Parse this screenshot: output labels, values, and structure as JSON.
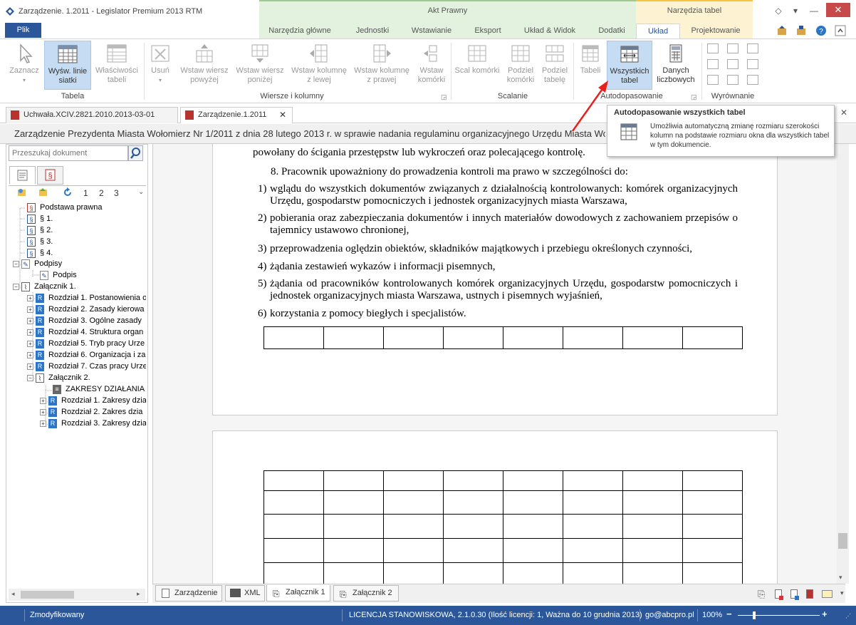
{
  "window": {
    "title": "Zarządzenie. 1.2011 - Legislator Premium 2013 RTM",
    "controls": [
      "◇",
      "▾",
      "—",
      "✕"
    ]
  },
  "context_groups": {
    "akt": "Akt Prawny",
    "tabele": "Narzędzia tabel"
  },
  "ribbon_tabs": [
    "Plik",
    "Narzędzia główne",
    "Jednostki",
    "Wstawianie",
    "Eksport",
    "Układ & Widok",
    "Dodatki",
    "Układ",
    "Projektowanie"
  ],
  "ribbon": {
    "buttons": {
      "zaznacz": "Zaznacz",
      "wysw1": "Wyśw. linie",
      "wysw2": "siatki",
      "wlasc1": "Właściwości",
      "wlasc2": "tabeli",
      "usun": "Usuń",
      "wwp1": "Wstaw wiersz",
      "wwp2": "powyżej",
      "wwn1": "Wstaw wiersz",
      "wwn2": "poniżej",
      "wkl1": "Wstaw kolumnę",
      "wkl2": "z lewej",
      "wkp1": "Wstaw kolumnę",
      "wkp2": "z prawej",
      "wk1": "Wstaw",
      "wk2": "komórki",
      "scal": "Scal komórki",
      "pk1": "Podziel",
      "pk2": "komórki",
      "pt1": "Podziel",
      "pt2": "tabelę",
      "tabeli": "Tabeli",
      "wt1": "Wszystkich",
      "wt2": "tabel",
      "dl1": "Danych",
      "dl2": "liczbowych"
    },
    "groups": [
      "Tabela",
      "Wiersze i kolumny",
      "Scalanie",
      "Autodopasowanie",
      "Wyrównanie"
    ]
  },
  "doc_tabs": [
    "Uchwała.XCIV.2821.2010.2013-03-01",
    "Zarządzenie.1.2011"
  ],
  "doc_title": "Zarządzenie Prezydenta Miasta Wołomierz Nr 1/2011 z dnia 28 lutego 2013 r. w sprawie nadania regulaminu organizacyjnego Urzędu Miasta Wołomierz",
  "tooltip": {
    "title": "Autodopasowanie wszystkich tabel",
    "body": "Umożliwia automatyczną zmianę rozmiaru szerokości kolumn na podstawie rozmiaru okna dla wszystkich tabel w tym dokumencie."
  },
  "search": {
    "placeholder": "Przeszukaj dokument"
  },
  "tree_toolbar": {
    "levels": [
      "1",
      "2",
      "3"
    ]
  },
  "tree": [
    {
      "label": "Podstawa prawna"
    },
    {
      "label": "§ 1."
    },
    {
      "label": "§ 2."
    },
    {
      "label": "§ 3."
    },
    {
      "label": "§ 4."
    },
    {
      "label": "Podpisy"
    },
    {
      "label": "Podpis"
    },
    {
      "label": "Załącznik 1."
    },
    {
      "label": "Rozdział 1. Postanowienia o"
    },
    {
      "label": "Rozdział 2. Zasady kierowa"
    },
    {
      "label": "Rozdział 3. Ogólne zasady"
    },
    {
      "label": "Rozdział 4. Struktura organ"
    },
    {
      "label": "Rozdział 5. Tryb pracy Urze"
    },
    {
      "label": "Rozdział 6. Organizacja i za"
    },
    {
      "label": "Rozdział 7. Czas pracy Urze"
    },
    {
      "label": "Załącznik 2."
    },
    {
      "label": "ZAKRESY DZIAŁANIA B"
    },
    {
      "label": "Rozdział 1. Zakresy dzia"
    },
    {
      "label": "Rozdział 2. Zakres dzia"
    },
    {
      "label": "Rozdział 3. Zakresy dzia"
    }
  ],
  "document": {
    "line0": "powołany do ścigania przestępstw lub wykroczeń oraz polecającego kontrolę.",
    "para8": "8. Pracownik upoważniony do prowadzenia kontroli ma prawo w szczególności do:",
    "items": [
      {
        "n": "1)",
        "t": "wglądu do wszystkich dokumentów związanych z działalnością kontrolowanych: komórek organizacyjnych Urzędu, gospodarstw pomocniczych i jednostek organizacyjnych miasta Warszawa,"
      },
      {
        "n": "2)",
        "t": "pobierania oraz zabezpieczania dokumentów i innych materiałów dowodowych z zachowaniem przepisów o tajemnicy ustawowo chronionej,"
      },
      {
        "n": "3)",
        "t": "przeprowadzenia oględzin obiektów, składników majątkowych i przebiegu określonych czynności,"
      },
      {
        "n": "4)",
        "t": "żądania zestawień wykazów i informacji pisemnych,"
      },
      {
        "n": "5)",
        "t": "żądania od pracowników kontrolowanych komórek organizacyjnych Urzędu, gospodarstw pomocniczych i jednostek organizacyjnych miasta Warszawa, ustnych i pisemnych wyjaśnień,"
      },
      {
        "n": "6)",
        "t": "korzystania z pomocy biegłych i specjalistów."
      }
    ]
  },
  "bottom_tabs": [
    "Zarządzenie",
    "XML",
    "Załącznik 1",
    "Załącznik 2"
  ],
  "status": {
    "state": "Zmodyfikowany",
    "license": "LICENCJA STANOWISKOWA, 2.1.0.30 (Ilość licencji: 1, Ważna do 10 grudnia 2013)",
    "email": "go@abcpro.pl",
    "zoom": "100%",
    "zoom_level": 0.2
  },
  "colors": {
    "accent": "#2b579a",
    "ctx_green": "#e3f2df",
    "ctx_yellow": "#fdf3d3",
    "arrow": "#e8201c"
  }
}
